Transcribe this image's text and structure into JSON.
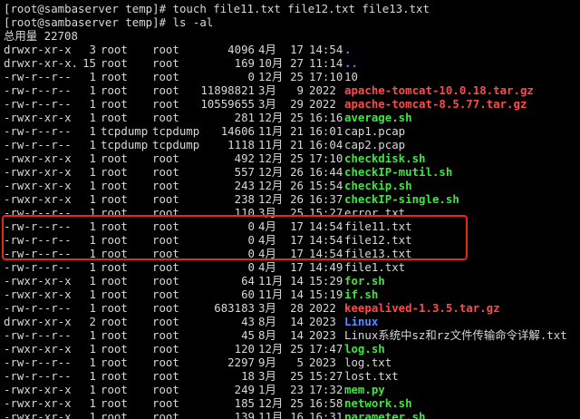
{
  "terminal": {
    "commands": [
      "[root@sambaserver temp]# touch file11.txt file12.txt file13.txt",
      "[root@sambaserver temp]# ls -al"
    ],
    "total_line": "总用量 22708",
    "entries": [
      {
        "perm": "drwxr-xr-x",
        "links": "3",
        "owner": "root",
        "group": "root",
        "size": "4096",
        "month": "4月",
        "day": "17",
        "time": "14:54",
        "name": ".",
        "type": "dir"
      },
      {
        "perm": "drwxr-xr-x.",
        "links": "15",
        "owner": "root",
        "group": "root",
        "size": "169",
        "month": "10月",
        "day": "27",
        "time": "11:14",
        "name": "..",
        "type": "dir"
      },
      {
        "perm": "-rw-r--r--",
        "links": "1",
        "owner": "root",
        "group": "root",
        "size": "0",
        "month": "12月",
        "day": "25",
        "time": "17:10",
        "name": "10",
        "type": "file"
      },
      {
        "perm": "-rw-r--r--",
        "links": "1",
        "owner": "root",
        "group": "root",
        "size": "11898821",
        "month": "3月",
        "day": "9",
        "time": "2022",
        "name": "apache-tomcat-10.0.18.tar.gz",
        "type": "archive"
      },
      {
        "perm": "-rw-r--r--",
        "links": "1",
        "owner": "root",
        "group": "root",
        "size": "10559655",
        "month": "3月",
        "day": "29",
        "time": "2022",
        "name": "apache-tomcat-8.5.77.tar.gz",
        "type": "archive"
      },
      {
        "perm": "-rwxr-xr-x",
        "links": "1",
        "owner": "root",
        "group": "root",
        "size": "281",
        "month": "12月",
        "day": "25",
        "time": "16:16",
        "name": "average.sh",
        "type": "exec"
      },
      {
        "perm": "-rw-r--r--",
        "links": "1",
        "owner": "tcpdump",
        "group": "tcpdump",
        "size": "14606",
        "month": "11月",
        "day": "21",
        "time": "16:01",
        "name": "cap1.pcap",
        "type": "file"
      },
      {
        "perm": "-rw-r--r--",
        "links": "1",
        "owner": "tcpdump",
        "group": "tcpdump",
        "size": "1118",
        "month": "11月",
        "day": "21",
        "time": "16:04",
        "name": "cap2.pcap",
        "type": "file"
      },
      {
        "perm": "-rwxr-xr-x",
        "links": "1",
        "owner": "root",
        "group": "root",
        "size": "492",
        "month": "12月",
        "day": "25",
        "time": "17:10",
        "name": "checkdisk.sh",
        "type": "exec"
      },
      {
        "perm": "-rwxr-xr-x",
        "links": "1",
        "owner": "root",
        "group": "root",
        "size": "557",
        "month": "12月",
        "day": "26",
        "time": "16:44",
        "name": "checkIP-mutil.sh",
        "type": "exec"
      },
      {
        "perm": "-rwxr-xr-x",
        "links": "1",
        "owner": "root",
        "group": "root",
        "size": "243",
        "month": "12月",
        "day": "26",
        "time": "15:54",
        "name": "checkip.sh",
        "type": "exec"
      },
      {
        "perm": "-rwxr-xr-x",
        "links": "1",
        "owner": "root",
        "group": "root",
        "size": "238",
        "month": "12月",
        "day": "26",
        "time": "16:37",
        "name": "checkIP-single.sh",
        "type": "exec"
      },
      {
        "perm": "-rw-r--r--",
        "links": "1",
        "owner": "root",
        "group": "root",
        "size": "110",
        "month": "3月",
        "day": "25",
        "time": "15:27",
        "name": "error.txt",
        "type": "file"
      },
      {
        "perm": "-rw-r--r--",
        "links": "1",
        "owner": "root",
        "group": "root",
        "size": "0",
        "month": "4月",
        "day": "17",
        "time": "14:54",
        "name": "file11.txt",
        "type": "file"
      },
      {
        "perm": "-rw-r--r--",
        "links": "1",
        "owner": "root",
        "group": "root",
        "size": "0",
        "month": "4月",
        "day": "17",
        "time": "14:54",
        "name": "file12.txt",
        "type": "file"
      },
      {
        "perm": "-rw-r--r--",
        "links": "1",
        "owner": "root",
        "group": "root",
        "size": "0",
        "month": "4月",
        "day": "17",
        "time": "14:54",
        "name": "file13.txt",
        "type": "file"
      },
      {
        "perm": "-rw-r--r--",
        "links": "1",
        "owner": "root",
        "group": "root",
        "size": "0",
        "month": "4月",
        "day": "17",
        "time": "14:49",
        "name": "file1.txt",
        "type": "file"
      },
      {
        "perm": "-rwxr-xr-x",
        "links": "1",
        "owner": "root",
        "group": "root",
        "size": "64",
        "month": "11月",
        "day": "14",
        "time": "15:29",
        "name": "for.sh",
        "type": "exec"
      },
      {
        "perm": "-rwxr-xr-x",
        "links": "1",
        "owner": "root",
        "group": "root",
        "size": "60",
        "month": "11月",
        "day": "14",
        "time": "15:19",
        "name": "if.sh",
        "type": "exec"
      },
      {
        "perm": "-rw-r--r--",
        "links": "1",
        "owner": "root",
        "group": "root",
        "size": "683183",
        "month": "3月",
        "day": "28",
        "time": "2022",
        "name": "keepalived-1.3.5.tar.gz",
        "type": "archive"
      },
      {
        "perm": "drwxr-xr-x",
        "links": "2",
        "owner": "root",
        "group": "root",
        "size": "43",
        "month": "8月",
        "day": "14",
        "time": "2023",
        "name": "Linux",
        "type": "dir"
      },
      {
        "perm": "-rw-r--r--",
        "links": "1",
        "owner": "root",
        "group": "root",
        "size": "45",
        "month": "8月",
        "day": "14",
        "time": "2023",
        "name": "Linux系统中sz和rz文件传输命令详解.txt",
        "type": "file"
      },
      {
        "perm": "-rwxr-xr-x",
        "links": "1",
        "owner": "root",
        "group": "root",
        "size": "120",
        "month": "12月",
        "day": "25",
        "time": "17:47",
        "name": "log.sh",
        "type": "exec"
      },
      {
        "perm": "-rw-r--r--",
        "links": "1",
        "owner": "root",
        "group": "root",
        "size": "2297",
        "month": "9月",
        "day": "5",
        "time": "2023",
        "name": "log.txt",
        "type": "file"
      },
      {
        "perm": "-rw-r--r--",
        "links": "1",
        "owner": "root",
        "group": "root",
        "size": "18",
        "month": "3月",
        "day": "25",
        "time": "15:27",
        "name": "lost.txt",
        "type": "file"
      },
      {
        "perm": "-rwxr-xr-x",
        "links": "1",
        "owner": "root",
        "group": "root",
        "size": "249",
        "month": "1月",
        "day": "23",
        "time": "17:32",
        "name": "mem.py",
        "type": "exec"
      },
      {
        "perm": "-rwxr-xr-x",
        "links": "1",
        "owner": "root",
        "group": "root",
        "size": "185",
        "month": "12月",
        "day": "25",
        "time": "16:58",
        "name": "network.sh",
        "type": "exec"
      },
      {
        "perm": "-rwxr-xr-x",
        "links": "1",
        "owner": "root",
        "group": "root",
        "size": "139",
        "month": "11月",
        "day": "16",
        "time": "16:31",
        "name": "parameter.sh",
        "type": "exec"
      }
    ]
  },
  "colors": {
    "background": "#000000",
    "text": "#d8d8d8",
    "directory": "#5c8cff",
    "executable": "#3ee63e",
    "archive": "#ff4a4a",
    "highlight_box": "#e8261b"
  }
}
